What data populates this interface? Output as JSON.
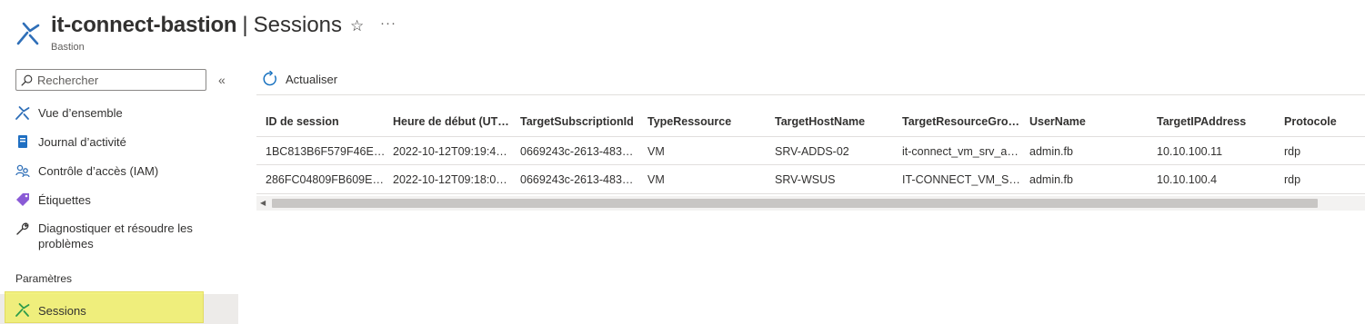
{
  "header": {
    "resource_name": "it-connect-bastion",
    "separator": "|",
    "page_title": "Sessions",
    "subtitle": "Bastion",
    "star_glyph": "☆",
    "more_glyph": "···",
    "resource_icon": "bastion-icon",
    "accent_colors": [
      "#2f6fb8",
      "#7ac043"
    ]
  },
  "sidebar": {
    "search_placeholder": "Rechercher",
    "collapse_glyph": "«",
    "items": [
      {
        "label": "Vue d’ensemble",
        "icon": "overview-bastion-icon"
      },
      {
        "label": "Journal d’activité",
        "icon": "activity-log-icon"
      },
      {
        "label": "Contrôle d’accès (IAM)",
        "icon": "iam-people-icon"
      },
      {
        "label": "Étiquettes",
        "icon": "tag-icon"
      },
      {
        "label": "Diagnostiquer et résoudre les problèmes",
        "icon": "wrench-icon"
      }
    ],
    "section_settings": "Paramètres",
    "active_item": {
      "label": "Sessions",
      "icon": "sessions-icon"
    }
  },
  "toolbar": {
    "refresh_label": "Actualiser",
    "refresh_icon": "refresh-icon"
  },
  "grid": {
    "columns": [
      "ID de session",
      "Heure de début (UT…",
      "TargetSubscriptionId",
      "TypeRessource",
      "TargetHostName",
      "TargetResourceGrou…",
      "UserName",
      "TargetIPAddress",
      "Protocole"
    ],
    "rows": [
      [
        "1BC813B6F579F46E…",
        "2022-10-12T09:19:4…",
        "0669243c-2613-483…",
        "VM",
        "SRV-ADDS-02",
        "it-connect_vm_srv_a…",
        "admin.fb",
        "10.10.100.11",
        "rdp"
      ],
      [
        "286FC04809FB609EC…",
        "2022-10-12T09:18:0…",
        "0669243c-2613-483…",
        "VM",
        "SRV-WSUS",
        "IT-CONNECT_VM_SR…",
        "admin.fb",
        "10.10.100.4",
        "rdp"
      ]
    ]
  },
  "scrollbar": {
    "left_arrow": "◀"
  }
}
